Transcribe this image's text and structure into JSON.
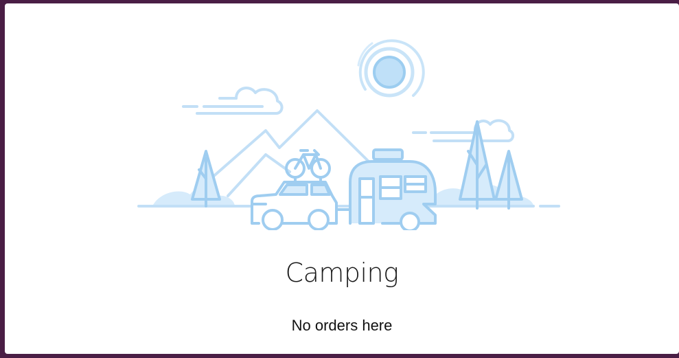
{
  "empty_state": {
    "title": "Camping",
    "message": "No orders here"
  },
  "colors": {
    "frame": "#4a1e45",
    "illustration_stroke": "#9fcdf0",
    "illustration_fill": "#d6ebfb",
    "illustration_light": "#c2dff6"
  }
}
